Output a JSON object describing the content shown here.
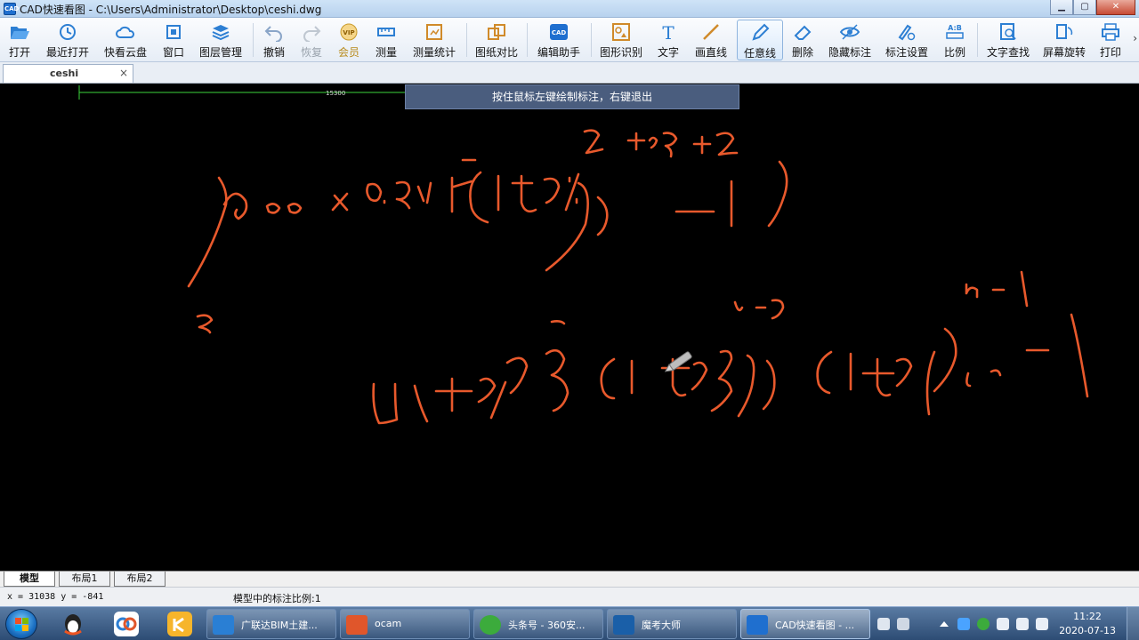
{
  "window": {
    "title": "CAD快速看图 - C:\\Users\\Administrator\\Desktop\\ceshi.dwg",
    "icon_label": "CAD",
    "controls": [
      "minimize",
      "maximize",
      "close"
    ],
    "control_glyphs": {
      "minimize": "▁",
      "maximize": "▢",
      "close": "✕"
    }
  },
  "toolbar": {
    "items": [
      {
        "id": "open",
        "label": "打开",
        "icon": "folder-open-icon"
      },
      {
        "id": "recent",
        "label": "最近打开",
        "icon": "clock-icon"
      },
      {
        "id": "cloud",
        "label": "快看云盘",
        "icon": "cloud-icon"
      },
      {
        "id": "window",
        "label": "窗口",
        "icon": "window-icon"
      },
      {
        "id": "layers",
        "label": "图层管理",
        "icon": "layers-icon"
      },
      {
        "id": "undo",
        "label": "撤销",
        "icon": "undo-icon"
      },
      {
        "id": "redo",
        "label": "恢复",
        "icon": "redo-icon"
      },
      {
        "id": "vip",
        "label": "会员",
        "icon": "vip-icon"
      },
      {
        "id": "measure",
        "label": "测量",
        "icon": "ruler-icon"
      },
      {
        "id": "measure-stats",
        "label": "测量统计",
        "icon": "measure-stats-icon"
      },
      {
        "id": "compare",
        "label": "图纸对比",
        "icon": "compare-icon"
      },
      {
        "id": "edit-assist",
        "label": "编辑助手",
        "icon": "edit-assist-icon"
      },
      {
        "id": "shape-recog",
        "label": "图形识别",
        "icon": "shape-recognition-icon"
      },
      {
        "id": "text",
        "label": "文字",
        "icon": "text-icon"
      },
      {
        "id": "line",
        "label": "画直线",
        "icon": "line-icon"
      },
      {
        "id": "freehand",
        "label": "任意线",
        "icon": "pen-icon"
      },
      {
        "id": "delete",
        "label": "删除",
        "icon": "eraser-icon"
      },
      {
        "id": "hide-marks",
        "label": "隐藏标注",
        "icon": "eye-icon"
      },
      {
        "id": "mark-settings",
        "label": "标注设置",
        "icon": "mark-settings-icon"
      },
      {
        "id": "scale",
        "label": "比例",
        "icon": "scale-ab-icon"
      },
      {
        "id": "find-text",
        "label": "文字查找",
        "icon": "find-text-icon"
      },
      {
        "id": "rotate-screen",
        "label": "屏幕旋转",
        "icon": "rotate-screen-icon"
      },
      {
        "id": "print",
        "label": "打印",
        "icon": "printer-icon"
      }
    ],
    "more_glyph": "›",
    "vip_badge": "VIP",
    "scale_badge_top": "A:B",
    "text_glyph": "T",
    "active_item": "freehand",
    "disabled_items": [
      "redo"
    ]
  },
  "document_tabs": [
    {
      "name": "ceshi",
      "close": "×"
    }
  ],
  "canvas": {
    "hint": "按住鼠标左键绘制标注，右键退出",
    "dimension_text": "15300",
    "stroke_color": "#e8592c",
    "dimension_color": "#3bd33b"
  },
  "layout_tabs": [
    "模型",
    "布局1",
    "布局2"
  ],
  "layout_active": "模型",
  "status": {
    "coords": "x = 31038  y = -841",
    "scale": "模型中的标注比例:1"
  },
  "taskbar": {
    "start_label": "start",
    "pinned": [
      "qq-icon",
      "baidu-netdisk-icon",
      "kuaizip-icon"
    ],
    "tasks": [
      {
        "label": "广联达BIM土建...",
        "icon": "glodon-icon",
        "color": "#2a7fd4"
      },
      {
        "label": "ocam",
        "icon": "ocam-icon",
        "color": "#e0562b"
      },
      {
        "label": "头条号 - 360安...",
        "icon": "browser-360-icon",
        "color": "#3cab3c"
      },
      {
        "label": "魔考大师",
        "icon": "mokao-icon",
        "color": "#1a5fa8"
      },
      {
        "label": "CAD快速看图 - ...",
        "icon": "cad-icon",
        "color": "#1f6fcf"
      }
    ],
    "active_task": 4,
    "clock_time": "11:22",
    "clock_date": "2020-07-13"
  }
}
